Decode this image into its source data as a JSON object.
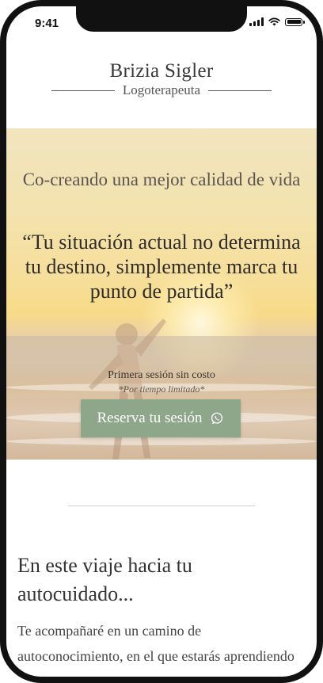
{
  "status_bar": {
    "time": "9:41"
  },
  "brand": {
    "name": "Brizia Sigler",
    "subtitle": "Logoterapeuta"
  },
  "hero": {
    "tagline": "Co-creando una mejor calidad de vida",
    "quote": "“Tu situación actual no determina tu destino, simplemente marca tu punto de partida”",
    "free_session": "Primera sesión sin costo",
    "limited": "*Por tiempo limitado*",
    "cta_label": "Reserva tu sesión"
  },
  "section": {
    "title": "En este viaje hacia tu autocuidado...",
    "body": "Te acompañaré en un camino de autoconocimiento, en el que estarás aprendiendo"
  },
  "colors": {
    "accent_green": "#8ea689",
    "text_dark": "#333333"
  },
  "icons": {
    "cta": "whatsapp-icon"
  }
}
